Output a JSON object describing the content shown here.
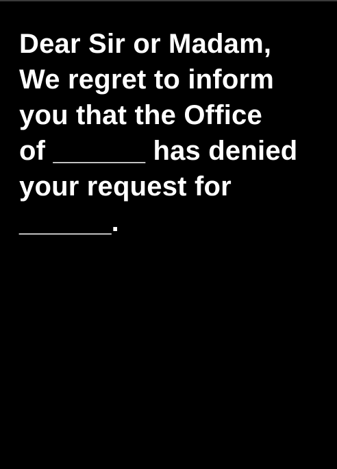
{
  "card": {
    "type": "black-card",
    "background": "#000000",
    "text_color": "#ffffff",
    "lines": [
      "Dear Sir or Madam,",
      "We regret to inform",
      "you that the Office",
      "of ______ has denied",
      "your request for",
      "______."
    ]
  }
}
